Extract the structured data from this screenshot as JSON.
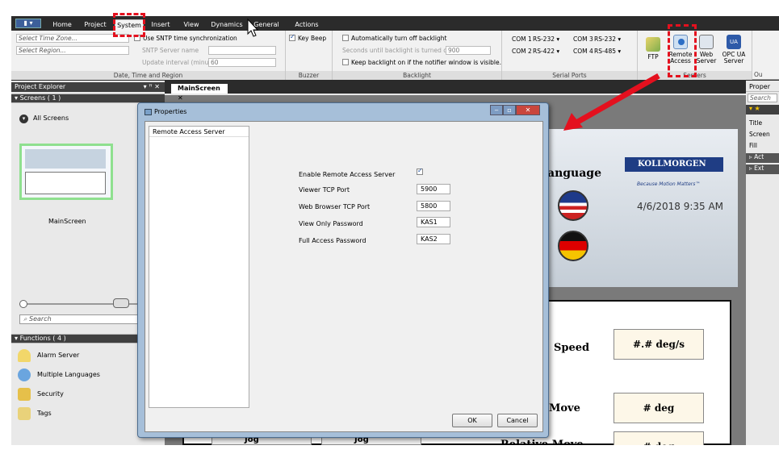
{
  "ribbon_tabs": [
    "Home",
    "Project",
    "System",
    "Insert",
    "View",
    "Dynamics",
    "General",
    "Actions"
  ],
  "active_tab": "System",
  "time_group": {
    "time_zone_placeholder": "Select Time Zone...",
    "region_placeholder": "Select Region...",
    "sntp_label": "Use SNTP time synchronization",
    "sntp_server_label": "SNTP Server name",
    "update_interval_label": "Update interval (minutes)",
    "update_interval_value": "60",
    "group_label": "Date, Time and Region"
  },
  "buzzer_group": {
    "key_beep": "Key Beep",
    "group_label": "Buzzer"
  },
  "backlight_group": {
    "auto_off": "Automatically turn off backlight",
    "seconds_label": "Seconds until backlight is turned off",
    "seconds_value": "900",
    "keep_on": "Keep backlight on if the notifier window is visible.",
    "group_label": "Backlight"
  },
  "serial_group": {
    "com1_label": "COM 1",
    "com1_value": "RS-232",
    "com2_label": "COM 2",
    "com2_value": "RS-422",
    "com3_label": "COM 3",
    "com3_value": "RS-232",
    "com4_label": "COM 4",
    "com4_value": "RS-485",
    "group_label": "Serial Ports"
  },
  "servers_group": {
    "ftp": "FTP",
    "remote_access_1": "Remote",
    "remote_access_2": "Access",
    "web_server_1": "Web",
    "web_server_2": "Server",
    "opc_ua_1": "OPC UA",
    "opc_ua_2": "Server",
    "group_label": "Servers"
  },
  "project_explorer": {
    "title": "Project Explorer",
    "pin_glyph": "▾ ꟸ ✕",
    "screens_section": "Screens ( 1 )",
    "all_screens": "All Screens",
    "screen_name": "MainScreen",
    "search_placeholder": "Search",
    "functions_section": "Functions ( 4 )",
    "functions": [
      "Alarm Server",
      "Multiple Languages",
      "Security",
      "Tags"
    ]
  },
  "doc_tab": "MainScreen",
  "screen_content": {
    "language_label": "anguage",
    "brand": "KOLLMORGEN",
    "tagline": "Because Motion Matters™",
    "datetime": "4/6/2018 9:35 AM",
    "speed_label": "Speed",
    "speed_value": "#.# deg/s",
    "move_label": "Move",
    "move_value": "# deg",
    "relative_move_label": "Relative Move",
    "relative_move_value": "# deg",
    "jog_label": "Jog"
  },
  "right_panel": {
    "title": "Proper",
    "search": "Search",
    "rows": [
      "Title",
      "Screen",
      "Fill"
    ],
    "sections": [
      "Act",
      "Ext"
    ],
    "top_right": "Ou"
  },
  "dialog": {
    "title": "Properties",
    "list_items": [
      "Remote Access Server"
    ],
    "fields": [
      {
        "label": "Enable Remote Access Server",
        "value": ""
      },
      {
        "label": "Viewer TCP Port",
        "value": "5900"
      },
      {
        "label": "Web Browser TCP Port",
        "value": "5800"
      },
      {
        "label": "View Only Password",
        "value": "KAS1"
      },
      {
        "label": "Full Access Password",
        "value": "KAS2"
      }
    ],
    "enable_checked": true,
    "ok": "OK",
    "cancel": "Cancel"
  },
  "colors": {
    "annotation": "#e4101e",
    "ribbon_bg": "#f1f1f1",
    "dark_bar": "#2b2b2b"
  }
}
